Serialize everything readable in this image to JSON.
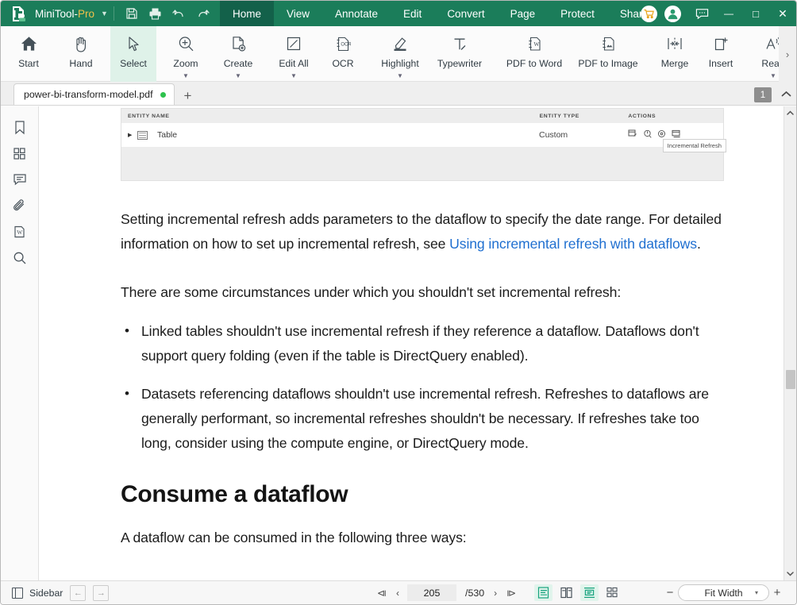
{
  "titlebar": {
    "app_name_main": "MiniTool-",
    "app_name_accent": "Pro",
    "quick_icons": [
      "save-icon",
      "print-icon",
      "undo-icon",
      "redo-icon"
    ],
    "menus": [
      {
        "label": "Home",
        "active": true
      },
      {
        "label": "View",
        "active": false
      },
      {
        "label": "Annotate",
        "active": false
      },
      {
        "label": "Edit",
        "active": false
      },
      {
        "label": "Convert",
        "active": false
      },
      {
        "label": "Page",
        "active": false
      },
      {
        "label": "Protect",
        "active": false
      },
      {
        "label": "Share",
        "active": false
      }
    ],
    "more_chevron": "›",
    "cart_icon": "cart-icon",
    "account_icon": "account-icon",
    "feedback_icon": "feedback-icon",
    "minimize": "—",
    "maximize": "□",
    "close": "✕",
    "accent_color": "#1b7d5a",
    "active_tab_color": "#13614a"
  },
  "ribbon": {
    "buttons": [
      {
        "label": "Start",
        "icon": "home-icon",
        "dropdown": false,
        "selected": false
      },
      {
        "label": "Hand",
        "icon": "hand-icon",
        "dropdown": false,
        "selected": false
      },
      {
        "label": "Select",
        "icon": "cursor-icon",
        "dropdown": false,
        "selected": true
      },
      {
        "label": "Zoom",
        "icon": "zoom-in-icon",
        "dropdown": true,
        "selected": false
      },
      {
        "label": "Create",
        "icon": "create-file-icon",
        "dropdown": true,
        "selected": false
      },
      {
        "label": "Edit All",
        "icon": "edit-all-icon",
        "dropdown": true,
        "selected": false
      },
      {
        "label": "OCR",
        "icon": "ocr-icon",
        "dropdown": false,
        "selected": false
      },
      {
        "label": "Highlight",
        "icon": "highlight-icon",
        "dropdown": true,
        "selected": false
      },
      {
        "label": "Typewriter",
        "icon": "typewriter-icon",
        "dropdown": false,
        "selected": false
      },
      {
        "label": "PDF to Word",
        "icon": "pdf-to-word-icon",
        "dropdown": false,
        "selected": false
      },
      {
        "label": "PDF to Image",
        "icon": "pdf-to-image-icon",
        "dropdown": false,
        "selected": false
      },
      {
        "label": "Merge",
        "icon": "merge-icon",
        "dropdown": false,
        "selected": false
      },
      {
        "label": "Insert",
        "icon": "insert-page-icon",
        "dropdown": false,
        "selected": false
      },
      {
        "label": "Read",
        "icon": "read-aloud-icon",
        "dropdown": true,
        "selected": false
      }
    ],
    "overflow_chevron": "›"
  },
  "tabbar": {
    "document_tab": "power-bi-transform-model.pdf",
    "modified_dot": true,
    "new_tab": "+",
    "page_badge": "1",
    "collapse_chevron": "⌃"
  },
  "sidebar": {
    "items": [
      {
        "name": "bookmark-icon"
      },
      {
        "name": "thumbnails-icon"
      },
      {
        "name": "comment-icon"
      },
      {
        "name": "attachment-icon"
      },
      {
        "name": "word-icon"
      },
      {
        "name": "search-icon"
      }
    ]
  },
  "document": {
    "screenshot_table": {
      "columns": [
        "ENTITY NAME",
        "ENTITY TYPE",
        "ACTIONS"
      ],
      "rows": [
        {
          "name": "Table",
          "type": "Custom",
          "actions": [
            "edit-table-icon",
            "refresh-icon",
            "settings-icon",
            "incremental-refresh-icon"
          ]
        }
      ],
      "tooltip": "Incremental Refresh"
    },
    "paragraph_1_a": "Setting incremental refresh adds parameters to the dataflow to specify the date range. For detailed information on how to set up incremental refresh, see ",
    "paragraph_1_link": "Using incremental refresh with dataflows",
    "paragraph_1_b": ".",
    "paragraph_2": "There are some circumstances under which you shouldn't set incremental refresh:",
    "bullets": [
      "Linked tables shouldn't use incremental refresh if they reference a dataflow. Dataflows don't support query folding (even if the table is DirectQuery enabled).",
      "Datasets referencing dataflows shouldn't use incremental refresh. Refreshes to dataflows are generally performant, so incremental refreshes shouldn't be necessary. If refreshes take too long, consider using the compute engine, or DirectQuery mode."
    ],
    "heading_2": "Consume a dataflow",
    "paragraph_3": "A dataflow can be consumed in the following three ways:",
    "link_color": "#1f6fd0"
  },
  "statusbar": {
    "sidebar_toggle_label": "Sidebar",
    "nav_back": "←",
    "nav_forward": "→",
    "first_page": "⧏",
    "prev_page": "‹",
    "current_page": "205",
    "total_pages": "/530",
    "next_page": "›",
    "last_page": "⧐",
    "view_modes": [
      {
        "name": "single-page-view",
        "active": true
      },
      {
        "name": "two-page-view",
        "active": false
      },
      {
        "name": "continuous-scroll-view",
        "active": true
      },
      {
        "name": "thumbnail-grid-view",
        "active": false
      }
    ],
    "zoom_out": "−",
    "zoom_level": "Fit Width",
    "zoom_caret": "▾",
    "zoom_in": "+"
  }
}
